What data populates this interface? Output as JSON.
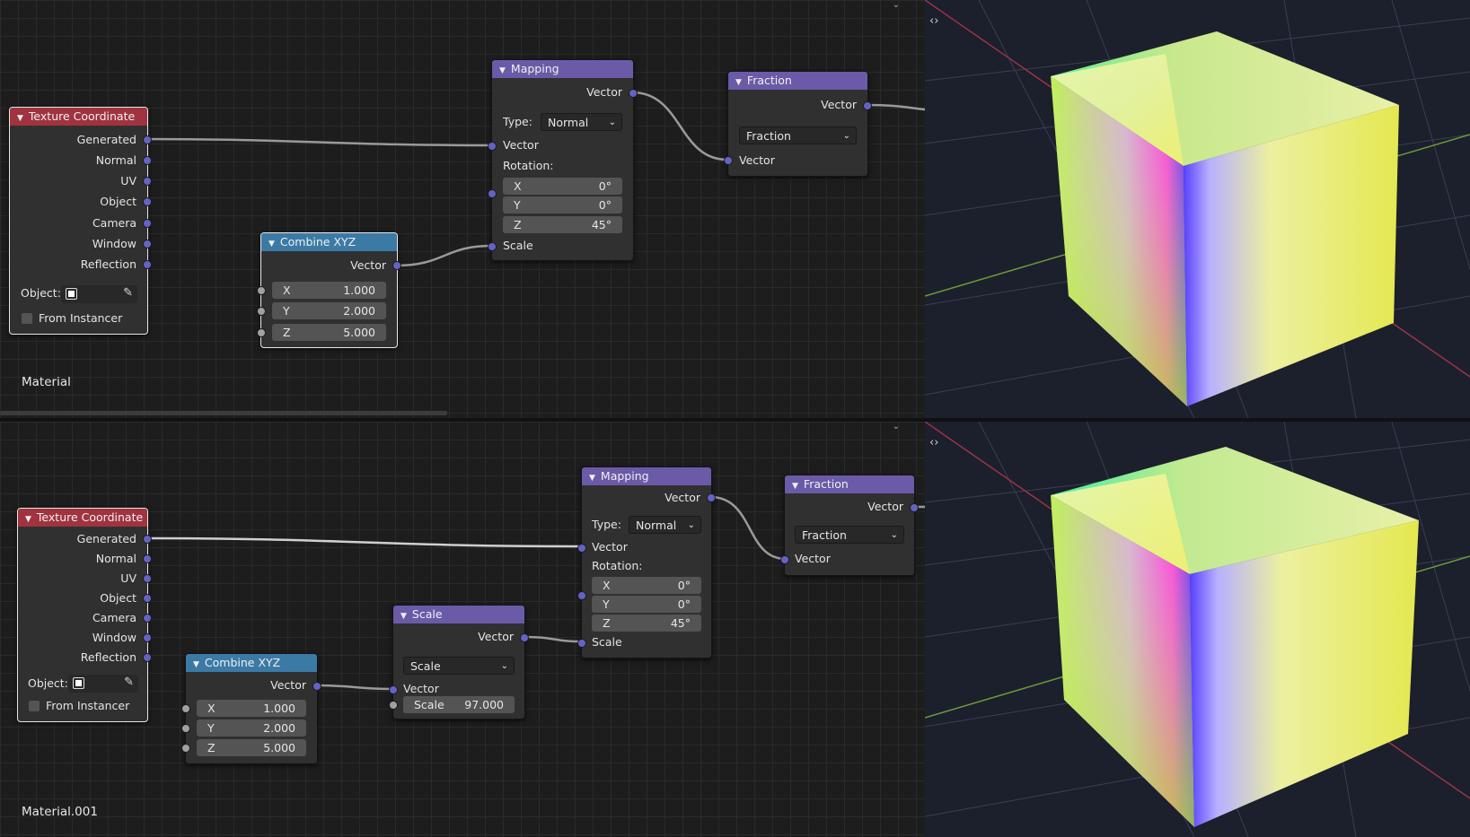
{
  "texture_coordinate": {
    "title": "Texture Coordinate",
    "outputs": [
      "Generated",
      "Normal",
      "UV",
      "Object",
      "Camera",
      "Window",
      "Reflection"
    ],
    "object_label": "Object:",
    "from_instancer_label": "From Instancer"
  },
  "combine_xyz": {
    "title": "Combine XYZ",
    "output": "Vector",
    "x_label": "X",
    "x_value": "1.000",
    "y_label": "Y",
    "y_value": "2.000",
    "z_label": "Z",
    "z_value": "5.000"
  },
  "mapping": {
    "title": "Mapping",
    "output": "Vector",
    "type_label": "Type:",
    "type_value": "Normal",
    "vector_input": "Vector",
    "rotation_label": "Rotation:",
    "rx_label": "X",
    "rx_value": "0°",
    "ry_label": "Y",
    "ry_value": "0°",
    "rz_label": "Z",
    "rz_value": "45°",
    "scale_input": "Scale"
  },
  "fraction": {
    "title": "Fraction",
    "output": "Vector",
    "operation": "Fraction",
    "input": "Vector"
  },
  "scale_node": {
    "title": "Scale",
    "output": "Vector",
    "operation": "Scale",
    "input": "Vector",
    "scale_label": "Scale",
    "scale_value": "97.000"
  },
  "editor1": {
    "material_name": "Material"
  },
  "editor2": {
    "material_name": "Material.001"
  },
  "icons": {
    "collapse": "chevron-down-icon",
    "nav": "navigate-arrows-icon",
    "eyedropper": "eyedropper-icon",
    "object": "object-icon"
  },
  "colors": {
    "texcoord_header": "#a0333f",
    "vector_header": "#6a5aa8",
    "input_header": "#3c7aa6",
    "socket_vector": "#6363c7",
    "socket_value": "#a1a1a1"
  }
}
